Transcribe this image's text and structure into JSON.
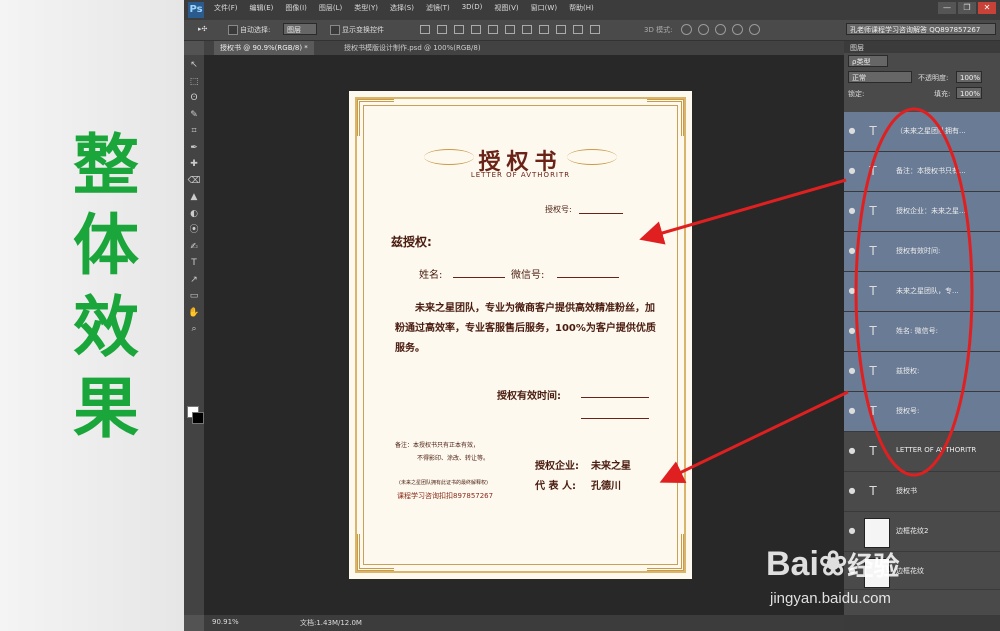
{
  "left_panel": {
    "characters": [
      "整",
      "体",
      "效",
      "果"
    ]
  },
  "app": {
    "logo": "Ps",
    "menu": [
      "文件(F)",
      "编辑(E)",
      "图像(I)",
      "图层(L)",
      "类型(Y)",
      "选择(S)",
      "滤镜(T)",
      "3D(D)",
      "视图(V)",
      "窗口(W)",
      "帮助(H)"
    ],
    "window_buttons": [
      "—",
      "❐",
      "✕"
    ],
    "workspace_label": "孔老师课程学习咨询解答 QQ897857267"
  },
  "options_bar": {
    "auto_select_label": "自动选择:",
    "auto_select_value": "图层",
    "transform_label": "显示变换控件",
    "mode_3d_label": "3D 模式:"
  },
  "tabs": [
    {
      "label": "授权书 @ 90.9%(RGB/8) *",
      "active": true
    },
    {
      "label": "授权书模版设计制作.psd @ 100%(RGB/8)",
      "active": false
    }
  ],
  "tools": [
    "↖",
    "⬚",
    "ʘ",
    "✎",
    "⌗",
    "✒",
    "✚",
    "⌫",
    "▲",
    "◐",
    "⦿",
    "✍",
    "T",
    "↗",
    "▭",
    "✋",
    "⌕"
  ],
  "document": {
    "title": "授权书",
    "subtitle": "LETTER OF AVTHORITR",
    "auth_no_label": "授权号:",
    "grant_label": "兹授权:",
    "name_label": "姓名:",
    "wechat_label": "微信号:",
    "body": "未来之星团队，专业为微商客户提供高效精准粉丝，加粉通过高效率，专业客服售后服务，100%为客户提供优质服务。",
    "valid_time_label": "授权有效时间:",
    "note_line1": "备注：本授权书只有正本有效，",
    "note_line2": "不得影印、涂改、转让等。",
    "rights_note": "(未来之星团队拥有此证书的最终解释权)",
    "contact": "课程学习咨询扣扣897857267",
    "company_label": "授权企业:",
    "company_value": "未来之星",
    "rep_label": "代 表 人:",
    "rep_value": "孔德川"
  },
  "layers_panel": {
    "title": "图层",
    "filter_kind": "ρ类型",
    "blend_mode": "正常",
    "opacity_label": "不透明度:",
    "opacity_value": "100%",
    "lock_label": "锁定:",
    "fill_label": "填充:",
    "fill_value": "100%",
    "layers": [
      {
        "name": "（未来之星团队拥有...",
        "kind": "text",
        "selected": true
      },
      {
        "name": "备注：本授权书只有...",
        "kind": "text",
        "selected": true
      },
      {
        "name": "授权企业：未来之星...",
        "kind": "text",
        "selected": true
      },
      {
        "name": "授权有效时间:",
        "kind": "text",
        "selected": true
      },
      {
        "name": "未来之星团队，专...",
        "kind": "text",
        "selected": true
      },
      {
        "name": "姓名:        微信号:",
        "kind": "text",
        "selected": true
      },
      {
        "name": "兹授权:",
        "kind": "text",
        "selected": true
      },
      {
        "name": "授权号:",
        "kind": "text",
        "selected": true
      },
      {
        "name": "LETTER OF AVTHORITR",
        "kind": "text",
        "selected": false
      },
      {
        "name": "授权书",
        "kind": "text",
        "selected": false
      },
      {
        "name": "边框花纹2",
        "kind": "image",
        "selected": false
      },
      {
        "name": "边框花纹",
        "kind": "image",
        "selected": false
      }
    ]
  },
  "status_bar": {
    "zoom": "90.91%",
    "doc_info": "文档:1.43M/12.0M"
  },
  "watermark": {
    "brand": "Bai",
    "brand_cn": "经验",
    "url": "jingyan.baidu.com"
  },
  "colors": {
    "accent_green": "#1aa63a",
    "annotation_red": "#e02020",
    "cert_text": "#6b2318",
    "selected_layer": "#6a7b95"
  }
}
